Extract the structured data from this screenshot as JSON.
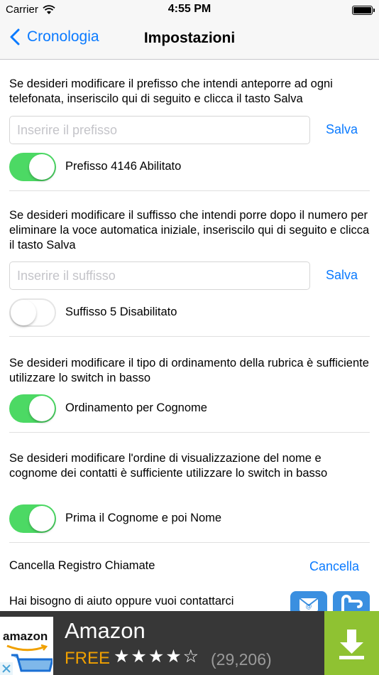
{
  "status_bar": {
    "carrier": "Carrier",
    "time": "4:55 PM"
  },
  "nav": {
    "back_label": "Cronologia",
    "title": "Impostazioni"
  },
  "prefix": {
    "description": "Se desideri modificare il prefisso che intendi anteporre ad ogni telefonata, inseriscilo qui di seguito e clicca il tasto Salva",
    "placeholder": "Inserire il prefisso",
    "value": "",
    "save_label": "Salva",
    "toggle_on": true,
    "toggle_label": "Prefisso 4146 Abilitato"
  },
  "suffix": {
    "description": "Se desideri modificare il suffisso che intendi porre dopo il numero per eliminare la voce automatica iniziale, inseriscilo qui di seguito e clicca il tasto Salva",
    "placeholder": "Inserire il suffisso",
    "value": "",
    "save_label": "Salva",
    "toggle_on": false,
    "toggle_label": "Suffisso 5 Disabilitato"
  },
  "sorting": {
    "description": "Se desideri modificare il tipo di ordinamento della rubrica è sufficiente utilizzare lo switch in basso",
    "toggle_on": true,
    "toggle_label": "Ordinamento per Cognome"
  },
  "display_order": {
    "description": "Se desideri modificare l'ordine di visualizzazione del nome e cognome dei contatti è sufficiente utilizzare lo switch in basso",
    "toggle_on": true,
    "toggle_label": "Prima il Cognome e poi Nome"
  },
  "clear_log": {
    "label": "Cancella Registro Chiamate",
    "button_label": "Cancella"
  },
  "help": {
    "label": "Hai bisogno di aiuto oppure vuoi contattarci"
  },
  "ad": {
    "logo_text": "amazon",
    "title": "Amazon",
    "price": "FREE",
    "stars": "★★★★☆",
    "rating_value": 3.5,
    "rating_count": "(29,206)"
  },
  "colors": {
    "accent": "#0a7aff",
    "toggle_on": "#4cd964",
    "ad_download": "#8fc232",
    "ad_price": "#f0a000"
  }
}
